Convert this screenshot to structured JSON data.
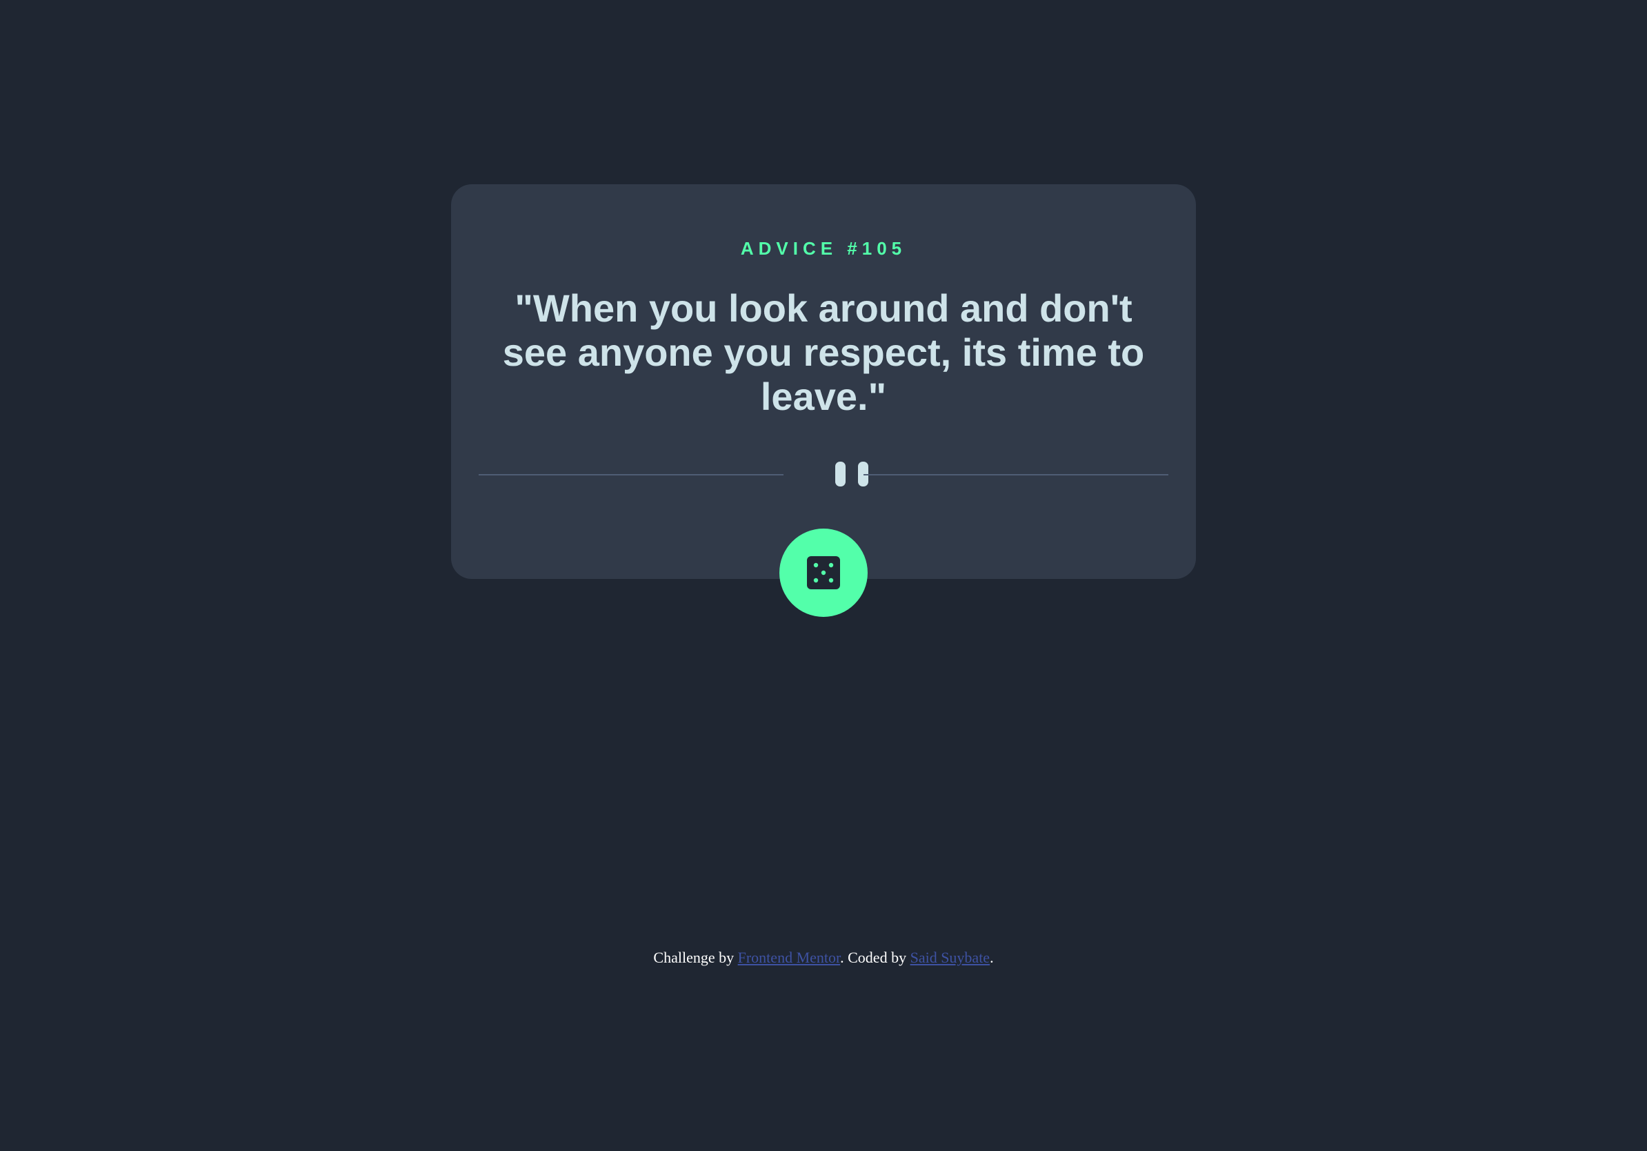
{
  "card": {
    "advice_label": "ADVICE #105",
    "quote": "\"When you look around and don't see anyone you respect, its time to leave.\""
  },
  "divider": {
    "icon": "pause-icon"
  },
  "button": {
    "icon": "dice-icon"
  },
  "footer": {
    "prefix": "Challenge by ",
    "link1": "Frontend Mentor",
    "middle": ". Coded by ",
    "link2": "Said Suybate",
    "suffix": "."
  },
  "colors": {
    "background": "#1f2632",
    "card": "#313a49",
    "accent": "#53ffaa",
    "quote_text": "#cee3e9",
    "divider": "#4f5d74",
    "link": "#3e52a3"
  }
}
